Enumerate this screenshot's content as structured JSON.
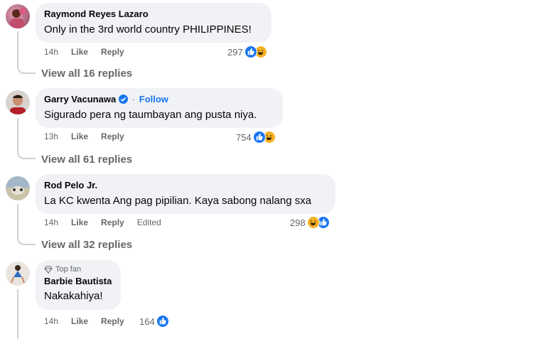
{
  "comments": [
    {
      "author": "Raymond Reyes Lazaro",
      "text": "Only in the 3rd world country PHILIPPINES!",
      "time": "14h",
      "like_label": "Like",
      "reply_label": "Reply",
      "reaction_count": "297",
      "reactions": [
        "like-icon",
        "haha-icon"
      ],
      "view_replies": "View all 16 replies"
    },
    {
      "author": "Garry Vacunawa",
      "verified": true,
      "follow_label": "Follow",
      "separator": "·",
      "text": "Sigurado pera ng taumbayan ang pusta niya.",
      "time": "13h",
      "like_label": "Like",
      "reply_label": "Reply",
      "reaction_count": "754",
      "reactions": [
        "like-icon",
        "haha-icon"
      ],
      "view_replies": "View all 61 replies"
    },
    {
      "author": "Rod Pelo Jr.",
      "text": "La KC kwenta Ang pag pipilian. Kaya sabong nalang sxa",
      "time": "14h",
      "like_label": "Like",
      "reply_label": "Reply",
      "edited_label": "Edited",
      "reaction_count": "298",
      "reactions": [
        "haha-icon",
        "like-icon"
      ],
      "view_replies": "View all 32 replies"
    },
    {
      "badge": "Top fan",
      "author": "Barbie Bautista",
      "text": "Nakakahiya!",
      "time": "14h",
      "like_label": "Like",
      "reply_label": "Reply",
      "reaction_count": "164",
      "reactions": [
        "like-icon"
      ]
    }
  ],
  "colors": {
    "link_blue": "#1877f2",
    "bubble_bg": "#f0f2f5",
    "meta_gray": "#65676b"
  }
}
